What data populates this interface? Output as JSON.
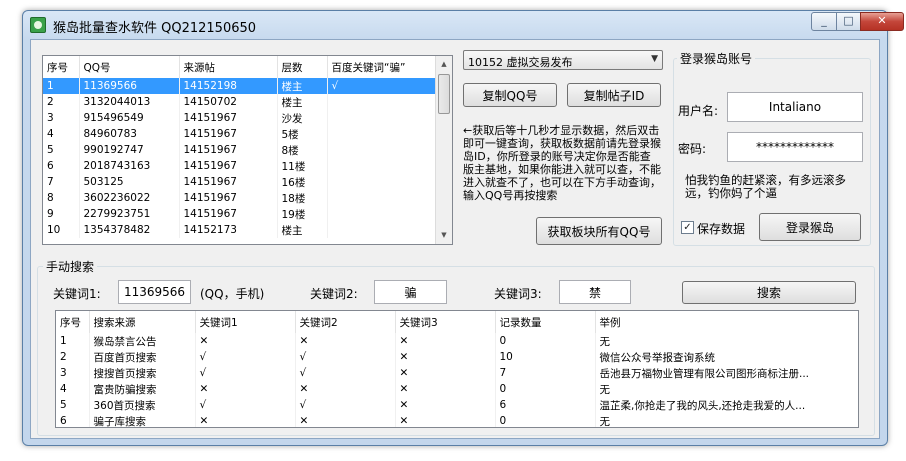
{
  "window": {
    "title": "猴岛批量查水软件 QQ212150650",
    "min_glyph": "_",
    "max_glyph": "□",
    "close_glyph": "✕"
  },
  "post_table": {
    "columns": [
      "序号",
      "QQ号",
      "来源帖",
      "层数",
      "百度关键词“骗”"
    ],
    "rows": [
      [
        "1",
        "11369566",
        "14152198",
        "楼主",
        "√"
      ],
      [
        "2",
        "3132044013",
        "14150702",
        "楼主",
        ""
      ],
      [
        "3",
        "915496549",
        "14151967",
        "沙发",
        ""
      ],
      [
        "4",
        "84960783",
        "14151967",
        "5楼",
        ""
      ],
      [
        "5",
        "990192747",
        "14151967",
        "8楼",
        ""
      ],
      [
        "6",
        "2018743163",
        "14151967",
        "11楼",
        ""
      ],
      [
        "7",
        "503125",
        "14151967",
        "16楼",
        ""
      ],
      [
        "8",
        "3602236022",
        "14151967",
        "18楼",
        ""
      ],
      [
        "9",
        "2279923751",
        "14151967",
        "19楼",
        ""
      ],
      [
        "10",
        "1354378482",
        "14152173",
        "楼主",
        ""
      ]
    ],
    "selected_index": 0
  },
  "board_select": {
    "value": "10152 虚拟交易发布",
    "arrow": "▼"
  },
  "buttons": {
    "copy_qq": "复制QQ号",
    "copy_post_id": "复制帖子ID",
    "fetch_all_qq": "获取板块所有QQ号",
    "login": "登录猴岛",
    "search": "搜索"
  },
  "info_text": "←获取后等十几秒才显示数据，然后双击即可一键查询，获取板数据前请先登录猴岛ID，你所登录的账号决定你是否能查版主基地，如果你能进入就可以查，不能进入就查不了，也可以在下方手动查询，输入QQ号再按搜索",
  "login_panel": {
    "title": "登录猴岛账号",
    "username_label": "用户名:",
    "username_value": "Intaliano",
    "password_label": "密码:",
    "password_value": "*************",
    "note": "怕我钓鱼的赶紧滚，有多远滚多远，钓你妈了个逼",
    "save_label": "保存数据",
    "save_checked": true,
    "check_glyph": "✓"
  },
  "manual_search": {
    "title": "手动搜索",
    "kw1_label": "关键词1:",
    "kw1_value": "11369566",
    "kw1_hint": "(QQ，手机)",
    "kw2_label": "关键词2:",
    "kw2_value": "骗",
    "kw3_label": "关键词3:",
    "kw3_value": "禁"
  },
  "results_table": {
    "columns": [
      "序号",
      "搜索来源",
      "关键词1",
      "关键词2",
      "关键词3",
      "记录数量",
      "举例"
    ],
    "rows": [
      [
        "1",
        "猴岛禁言公告",
        "✕",
        "✕",
        "✕",
        "0",
        "无"
      ],
      [
        "2",
        "百度首页搜索",
        "√",
        "√",
        "✕",
        "10",
        "微信公众号举报查询系统"
      ],
      [
        "3",
        "搜搜首页搜索",
        "√",
        "√",
        "✕",
        "7",
        "岳池县万福物业管理有限公司图形商标注册..."
      ],
      [
        "4",
        "富贵防骗搜索",
        "✕",
        "✕",
        "✕",
        "0",
        "无"
      ],
      [
        "5",
        "360首页搜索",
        "√",
        "√",
        "✕",
        "6",
        "温芷柔,你抢走了我的风头,还抢走我爱的人..."
      ],
      [
        "6",
        "骗子库搜索",
        "✕",
        "✕",
        "✕",
        "0",
        "无"
      ]
    ]
  }
}
